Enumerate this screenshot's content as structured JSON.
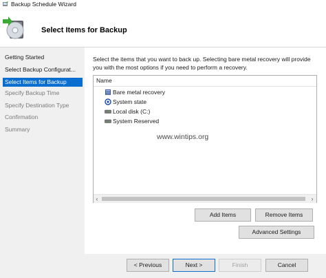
{
  "window": {
    "title": "Backup Schedule Wizard"
  },
  "header": {
    "title": "Select Items for Backup",
    "icon": "backup-wizard-icon"
  },
  "nav": {
    "items": [
      {
        "label": "Getting Started",
        "state": "done"
      },
      {
        "label": "Select Backup Configurat...",
        "state": "done"
      },
      {
        "label": "Select Items for Backup",
        "state": "active"
      },
      {
        "label": "Specify Backup Time",
        "state": "pending"
      },
      {
        "label": "Specify Destination Type",
        "state": "pending"
      },
      {
        "label": "Confirmation",
        "state": "pending"
      },
      {
        "label": "Summary",
        "state": "pending"
      }
    ]
  },
  "main": {
    "instructions": "Select the items that you want to back up. Selecting bare metal recovery will provide you with the most options if you need to perform a recovery.",
    "list": {
      "column": "Name",
      "items": [
        {
          "label": "Bare metal recovery",
          "icon": "server-icon"
        },
        {
          "label": "System state",
          "icon": "system-state-icon"
        },
        {
          "label": "Local disk (C:)",
          "icon": "drive-icon"
        },
        {
          "label": "System Reserved",
          "icon": "drive-icon"
        }
      ]
    },
    "watermark": "www.wintips.org",
    "buttons": {
      "add_items": "Add Items",
      "remove_items": "Remove Items",
      "advanced_settings": "Advanced Settings"
    }
  },
  "footer": {
    "previous": "< Previous",
    "next": "Next >",
    "finish": "Finish",
    "cancel": "Cancel"
  },
  "colors": {
    "accent": "#0a6ed1",
    "panel": "#f0f0f0"
  }
}
